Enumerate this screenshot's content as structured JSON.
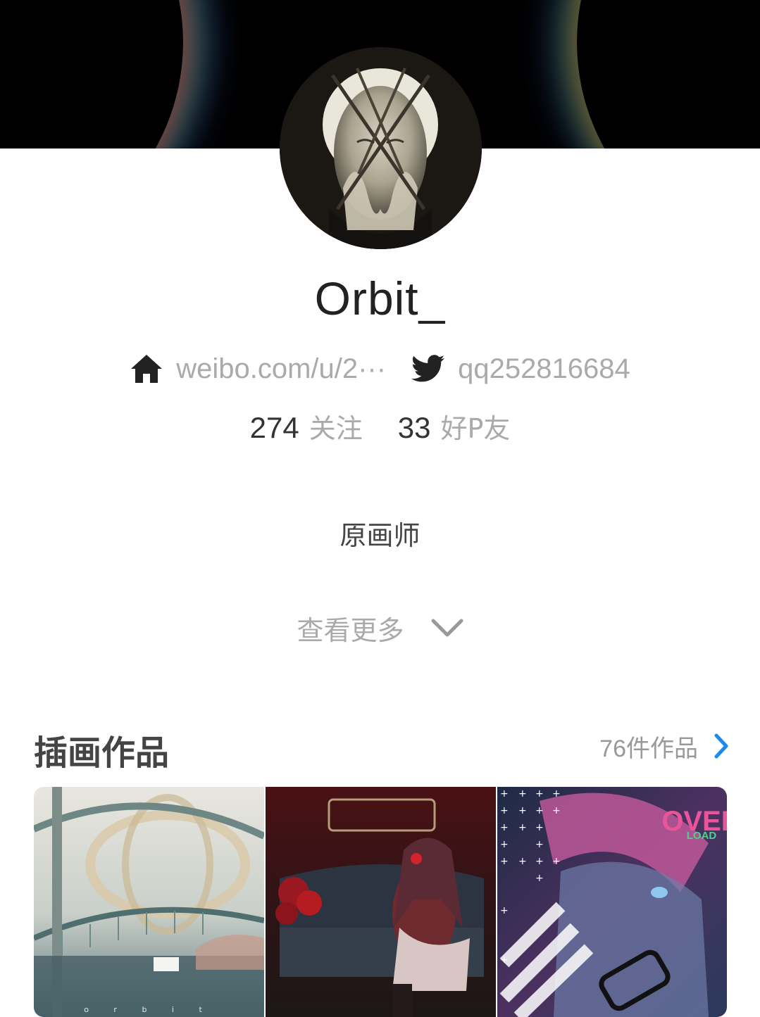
{
  "profile": {
    "name": "Orbit_",
    "homepage_link": "weibo.com/u/2···",
    "twitter_handle": "qq252816684",
    "following_count": "274",
    "following_label": "关注",
    "friends_count": "33",
    "friends_label": "好P友",
    "bio": "原画师",
    "view_more_label": "查看更多"
  },
  "illustrations": {
    "title": "插画作品",
    "count_label": "76件作品",
    "items": [
      {
        "name": "orbit-artwork",
        "caption": "o r b i t"
      },
      {
        "name": "gothic-lolita-artwork"
      },
      {
        "name": "overload-artwork",
        "logo_top": "OVER",
        "logo_bottom": "LOAD"
      }
    ]
  },
  "colors": {
    "accent": "#1a8cf0",
    "text_primary": "#222222",
    "text_secondary": "#aaaaaa"
  },
  "icons": {
    "home": "home-icon",
    "twitter": "twitter-icon",
    "view_more": "chevron-down-icon",
    "see_all": "chevron-right-icon"
  }
}
